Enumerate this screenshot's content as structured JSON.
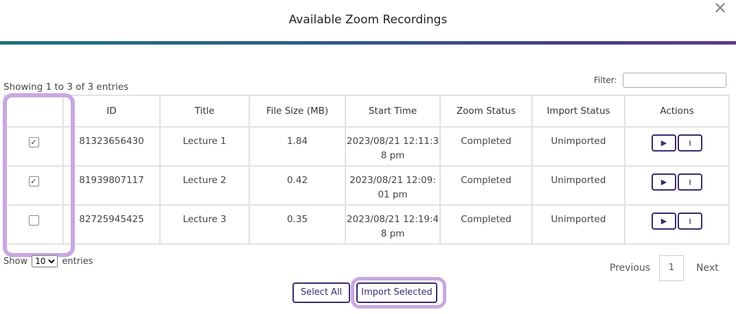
{
  "modal": {
    "title": "Available Zoom Recordings",
    "close_glyph": "✕"
  },
  "table_info": {
    "showing": "Showing 1 to 3 of 3 entries",
    "filter_label": "Filter:",
    "filter_value": ""
  },
  "columns": [
    "",
    "ID",
    "Title",
    "File Size (MB)",
    "Start Time",
    "Zoom Status",
    "Import Status",
    "Actions"
  ],
  "rows": [
    {
      "checked": true,
      "id": "81323656430",
      "title": "Lecture 1",
      "size": "1.84",
      "start_l1": "2023/08/21 12:11:3",
      "start_l2": "8 pm",
      "zoom_status": "Completed",
      "import_status": "Unimported"
    },
    {
      "checked": true,
      "id": "81939807117",
      "title": "Lecture 2",
      "size": "0.42",
      "start_l1": "2023/08/21 12:09:",
      "start_l2": "01 pm",
      "zoom_status": "Completed",
      "import_status": "Unimported"
    },
    {
      "checked": false,
      "id": "82725945425",
      "title": "Lecture 3",
      "size": "0.35",
      "start_l1": "2023/08/21 12:19:4",
      "start_l2": "8 pm",
      "zoom_status": "Completed",
      "import_status": "Unimported"
    }
  ],
  "icons": {
    "play": "▶",
    "download": "⭳",
    "check": "✓"
  },
  "length_control": {
    "show": "Show",
    "value": "10",
    "entries": "entries"
  },
  "pagination": {
    "previous": "Previous",
    "page": "1",
    "next": "Next"
  },
  "buttons": {
    "select_all": "Select All",
    "import_selected": "Import Selected"
  },
  "colors": {
    "accent": "#3b2a6b",
    "highlight": "#c9a7e1",
    "header_gradient_start": "#1b6f80",
    "header_gradient_end": "#5e3a8c"
  }
}
